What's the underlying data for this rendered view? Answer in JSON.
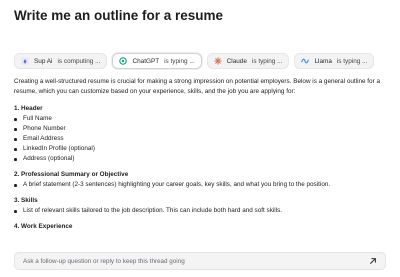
{
  "page": {
    "title": "Write me an outline for a resume"
  },
  "models": [
    {
      "name": "Sup Ai",
      "status": "is computing ...",
      "icon": "sup-ai-icon",
      "color": "#5b5bd6"
    },
    {
      "name": "ChatGPT",
      "status": "is typing ...",
      "icon": "chatgpt-icon",
      "color": "#10a37f"
    },
    {
      "name": "Claude",
      "status": "is typing ...",
      "icon": "claude-icon",
      "color": "#d97757"
    },
    {
      "name": "Llama",
      "status": "is typing ...",
      "icon": "llama-icon",
      "color": "#4a90e2"
    }
  ],
  "response": {
    "intro": "Creating a well-structured resume is crucial for making a strong impression on potential employers. Below is a general outline for a resume, which you can customize based on your experience, skills, and the job you are applying for:",
    "sections": [
      {
        "heading": "1. Header",
        "items": [
          "Full Name",
          "Phone Number",
          "Email Address",
          "LinkedIn Profile (optional)",
          "Address (optional)"
        ]
      },
      {
        "heading": "2. Professional Summary or Objective",
        "items": [
          "A brief statement (2-3 sentences) highlighting your career goals, key skills, and what you bring to the position."
        ]
      },
      {
        "heading": "3. Skills",
        "items": [
          "List of relevant skills tailored to the job description. This can include both hard and soft skills."
        ]
      },
      {
        "heading": "4. Work Experience",
        "items": []
      }
    ]
  },
  "followup": {
    "placeholder": "Ask a follow-up question or reply to keep this thread going"
  }
}
